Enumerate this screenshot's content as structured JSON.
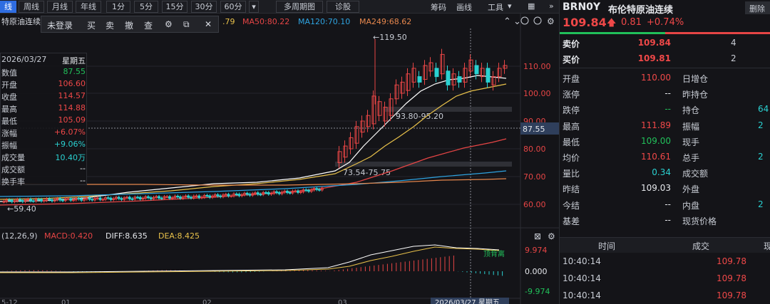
{
  "toolbar": {
    "items": [
      "线",
      "周线",
      "月线",
      "年线",
      "1分",
      "5分",
      "15分",
      "30分",
      "60分",
      "多周期图",
      "诊股"
    ],
    "active_index": 0,
    "right_items": [
      "筹码",
      "画线",
      "工具"
    ]
  },
  "ma": {
    "partial": ".79",
    "ma50": "MA50:80.22",
    "ma120": "MA120:70.10",
    "ma249": "MA249:68.62"
  },
  "chart_title": "特原油连续",
  "popup": [
    "未登录",
    "买",
    "卖",
    "撤",
    "查"
  ],
  "info": {
    "date": "2026/03/27",
    "weekday": "星期五",
    "rows": [
      {
        "k": "数值",
        "v": "87.55",
        "c": "green"
      },
      {
        "k": "开盘",
        "v": "106.60",
        "c": "red"
      },
      {
        "k": "收盘",
        "v": "114.57",
        "c": "red"
      },
      {
        "k": "最高",
        "v": "114.88",
        "c": "red"
      },
      {
        "k": "最低",
        "v": "105.09",
        "c": "red"
      },
      {
        "k": "涨幅",
        "v": "+6.07%",
        "c": "red"
      },
      {
        "k": "振幅",
        "v": "+9.06%",
        "c": "cyan"
      },
      {
        "k": "成交量",
        "v": "10.40万",
        "c": "cyan"
      },
      {
        "k": "成交额",
        "v": "--",
        "c": "white"
      },
      {
        "k": "换手率",
        "v": "--",
        "c": "white"
      }
    ]
  },
  "annotations": {
    "high": "119.50",
    "low": "59.40",
    "range1": "93.80-95.20",
    "range2": "73.54-75.75",
    "cursor_price": "87.55",
    "cursor_date": "2026/03/27 星期五"
  },
  "price_axis": [
    "110.00",
    "100.00",
    "90.00",
    "80.00",
    "70.00",
    "60.00"
  ],
  "macd": {
    "params": "(12,26,9)",
    "macd": "MACD:0.420",
    "diff": "DIFF:8.635",
    "dea": "DEA:8.425",
    "axis": [
      "9.974",
      "0.000",
      "-9.974"
    ],
    "label": "顶背离"
  },
  "date_axis": [
    "5-12",
    "01",
    "02",
    "03"
  ],
  "right": {
    "code": "BRN0Y",
    "name": "布伦特原油连续",
    "tab": "删除",
    "price": "109.84",
    "change": "0.81",
    "pct": "+0.74%",
    "sell_label": "卖价",
    "sell_price": "109.84",
    "sell_qty": "4",
    "buy_label": "买价",
    "buy_price": "109.81",
    "buy_qty": "2",
    "stats": [
      {
        "k1": "开盘",
        "v1": "110.00",
        "c1": "red",
        "k2": "日增仓",
        "v2": ""
      },
      {
        "k1": "涨停",
        "v1": "--",
        "c1": "white",
        "k2": "昨持仓",
        "v2": ""
      },
      {
        "k1": "跌停",
        "v1": "--",
        "c1": "green",
        "k2": "持仓",
        "v2": "64"
      },
      {
        "k1": "最高",
        "v1": "111.89",
        "c1": "red",
        "k2": "振幅",
        "v2": "2"
      },
      {
        "k1": "最低",
        "v1": "109.00",
        "c1": "green",
        "k2": "现手",
        "v2": ""
      },
      {
        "k1": "均价",
        "v1": "110.61",
        "c1": "red",
        "k2": "总手",
        "v2": "2"
      },
      {
        "k1": "量比",
        "v1": "0.34",
        "c1": "cyan",
        "k2": "成交额",
        "v2": ""
      },
      {
        "k1": "昨结",
        "v1": "109.03",
        "c1": "white",
        "k2": "外盘",
        "v2": ""
      },
      {
        "k1": "今结",
        "v1": "--",
        "c1": "white",
        "k2": "内盘",
        "v2": "2"
      },
      {
        "k1": "基差",
        "v1": "--",
        "c1": "white",
        "k2": "现货价格",
        "v2": ""
      }
    ],
    "trades_header": [
      "时间",
      "成交",
      "现"
    ],
    "trades": [
      {
        "time": "10:40:14",
        "price": "109.78"
      },
      {
        "time": "10:40:14",
        "price": "109.78"
      },
      {
        "time": "10:40:14",
        "price": "109.78"
      }
    ]
  }
}
